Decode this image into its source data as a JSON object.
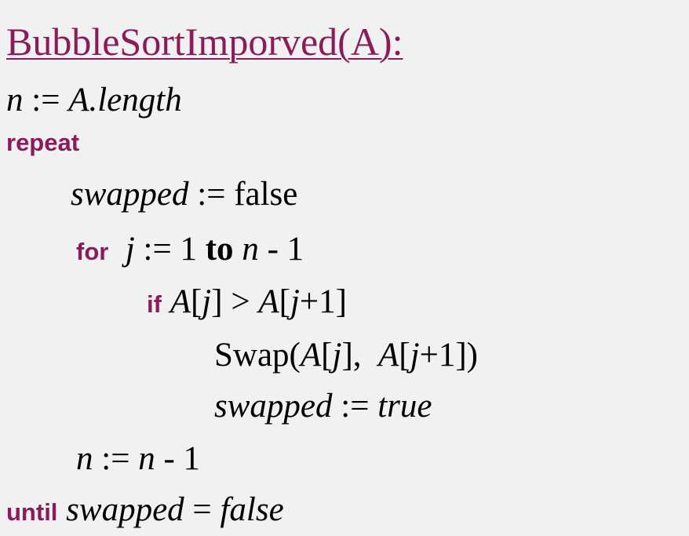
{
  "title": "BubbleSortImporved(A):",
  "lines": {
    "l1": {
      "n": "n",
      "assign": " := ",
      "expr": "A.length"
    },
    "l2": {
      "kw": "repeat"
    },
    "l3": {
      "var": "swapped",
      "assign": " := false"
    },
    "l4": {
      "kw": "for",
      "sp": "  ",
      "j": "j",
      "assign": " := 1 ",
      "to": "to",
      "sp2": " ",
      "n": "n",
      "rest": " - 1"
    },
    "l5": {
      "kw": "if",
      "sp": " ",
      "a1": "A",
      "b1": "[",
      "j1": "j",
      "b2": "] > ",
      "a2": "A",
      "b3": "[",
      "j2": "j",
      "b4": "+1]"
    },
    "l6": {
      "swap": "Swap(",
      "a1": "A",
      "b1": "[",
      "j1": "j",
      "b2": "],  ",
      "a2": "A",
      "b3": "[",
      "j2": "j",
      "b4": "+1])"
    },
    "l7": {
      "var": "swapped",
      "assign": " := ",
      "val": "true"
    },
    "l8": {
      "n1": "n",
      "assign": " := ",
      "n2": "n",
      "rest": " - 1"
    },
    "l9": {
      "kw": "until",
      "sp": " ",
      "var": "swapped",
      "eq": " = ",
      "val": "false"
    }
  },
  "colors": {
    "keyword": "#8b1c5a",
    "text": "#000000",
    "background": "#f1f1f1"
  }
}
